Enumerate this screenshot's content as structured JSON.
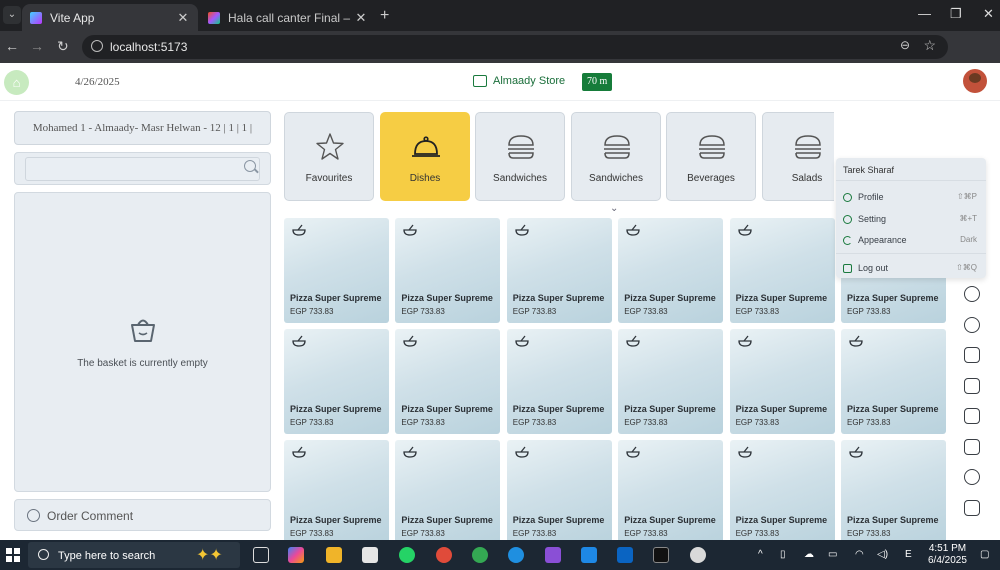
{
  "browser": {
    "tabs": [
      {
        "title": "Vite App",
        "active": true
      },
      {
        "title": "Hala call canter Final – Figma",
        "active": false
      }
    ],
    "url": "localhost:5173",
    "profile_initial": "M",
    "new_tab": "+",
    "controls": {
      "minimize": "—",
      "restore": "❐",
      "close": "✕"
    }
  },
  "header": {
    "date": "4/26/2025",
    "store_name": "Almaady Store",
    "time_badge": "70 m"
  },
  "left_panel": {
    "customer": "Mohamed 1 - Almaady- Masr Helwan - 12 | 1 | 1 |",
    "search_placeholder": "",
    "basket_empty": "The basket is currently empty",
    "order_comment": "Order Comment"
  },
  "categories": [
    {
      "label": "Favourites",
      "icon": "star-icon",
      "active": false
    },
    {
      "label": "Dishes",
      "icon": "cloche-icon",
      "active": true
    },
    {
      "label": "Sandwiches",
      "icon": "burger-icon",
      "active": false
    },
    {
      "label": "Sandwiches",
      "icon": "burger-icon",
      "active": false
    },
    {
      "label": "Beverages",
      "icon": "burger-icon",
      "active": false
    },
    {
      "label": "Salads",
      "icon": "burger-icon",
      "active": false
    }
  ],
  "products": {
    "name": "Pizza Super Supreme",
    "price": "EGP 733.83",
    "rows": 3,
    "cols": 6
  },
  "user_menu": {
    "name": "Tarek Sharaf",
    "items": [
      {
        "label": "Profile",
        "shortcut": "⇧⌘P",
        "icon": "user-icon"
      },
      {
        "label": "Setting",
        "shortcut": "⌘+T",
        "icon": "gear-icon"
      },
      {
        "label": "Appearance",
        "shortcut": "Dark",
        "icon": "moon-icon"
      },
      {
        "label": "Log out",
        "shortcut": "⇧⌘Q",
        "icon": "logout-icon"
      }
    ]
  },
  "right_rail": [
    "percent-icon",
    "alarm-icon",
    "headset-icon",
    "scooter-icon",
    "clipboard-icon",
    "card-icon",
    "checklist-icon",
    "receipt-icon",
    "hand-icon",
    "trash-icon"
  ],
  "taskbar": {
    "search_placeholder": "Type here to search",
    "time": "4:51 PM",
    "date": "6/4/2025",
    "lang": "E"
  },
  "colors": {
    "accent_yellow": "#f6cd44",
    "brand_green": "#167c3a"
  }
}
